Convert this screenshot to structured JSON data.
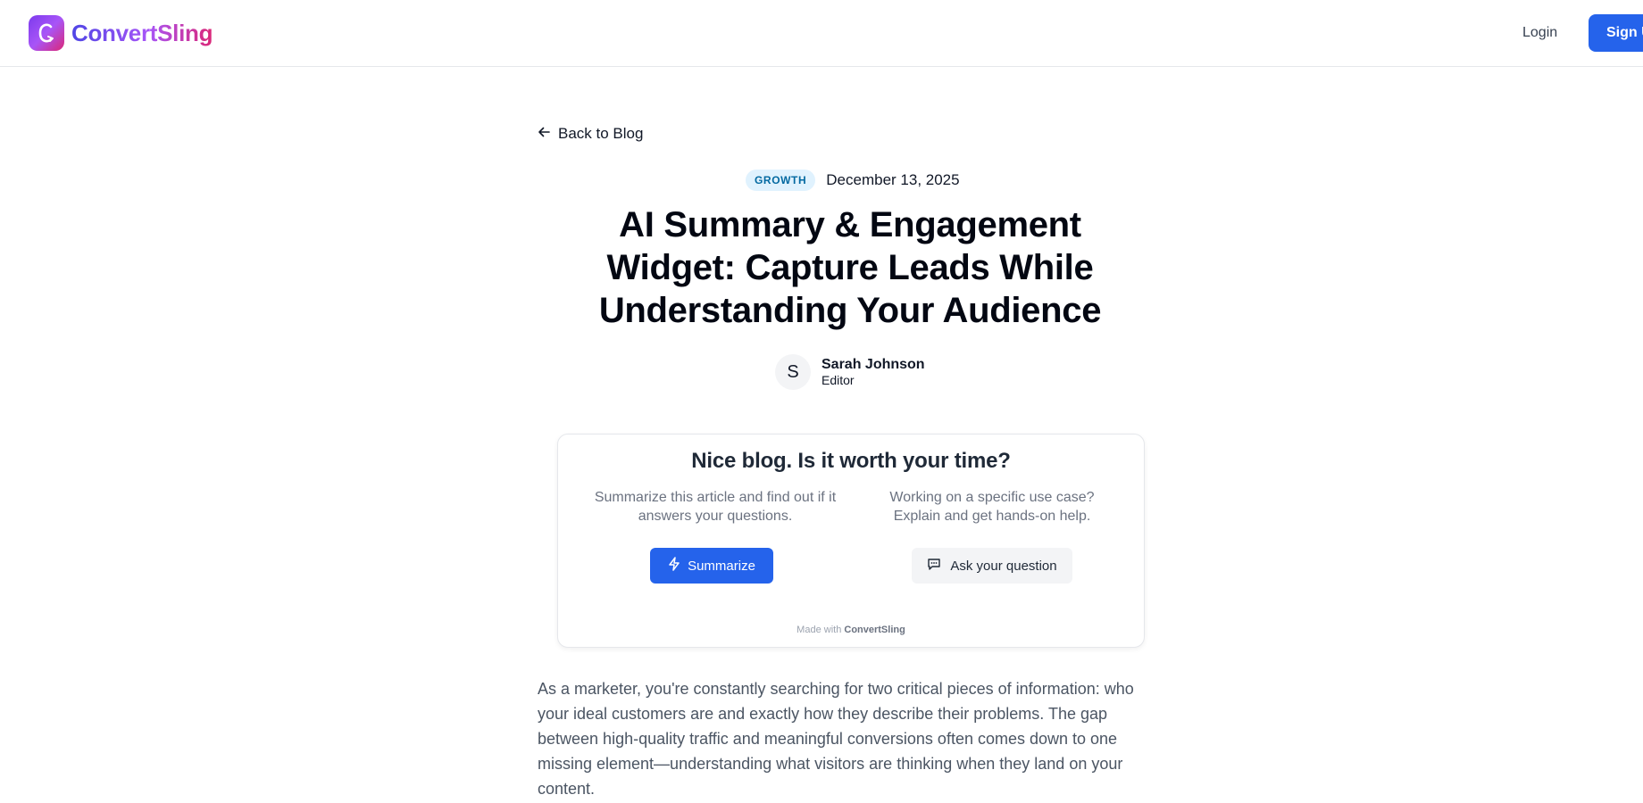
{
  "navbar": {
    "brand": "ConvertSling",
    "login": "Login",
    "signup": "Sign Up"
  },
  "article": {
    "back_label": "Back to Blog",
    "category": "GROWTH",
    "date": "December 13, 2025",
    "title": "AI Summary & Engagement Widget: Capture Leads While Understanding Your Audience",
    "author": {
      "initial": "S",
      "name": "Sarah Johnson",
      "role": "Editor"
    },
    "intro": "As a marketer, you're constantly searching for two critical pieces of information: who your ideal customers are and exactly how they describe their problems. The gap between high-quality traffic and meaningful conversions often comes down to one missing element—understanding what visitors are thinking when they land on your content."
  },
  "widget": {
    "heading": "Nice blog. Is it worth your time?",
    "left_text": "Summarize this article and find out if it answers your questions.",
    "right_text": "Working on a specific use case? Explain and get hands-on help.",
    "summarize_label": "Summarize",
    "ask_label": "Ask your question",
    "made_with_prefix": "Made with",
    "made_with_brand": "ConvertSling"
  },
  "colors": {
    "primary": "#2563eb",
    "tag_bg": "#e0f2fe",
    "tag_text": "#0369a1"
  },
  "icons": {
    "back": "arrow-left-icon",
    "summarize": "lightning-bolt-icon",
    "ask": "chat-bubble-icon",
    "logo": "convertsling-logo-icon"
  }
}
